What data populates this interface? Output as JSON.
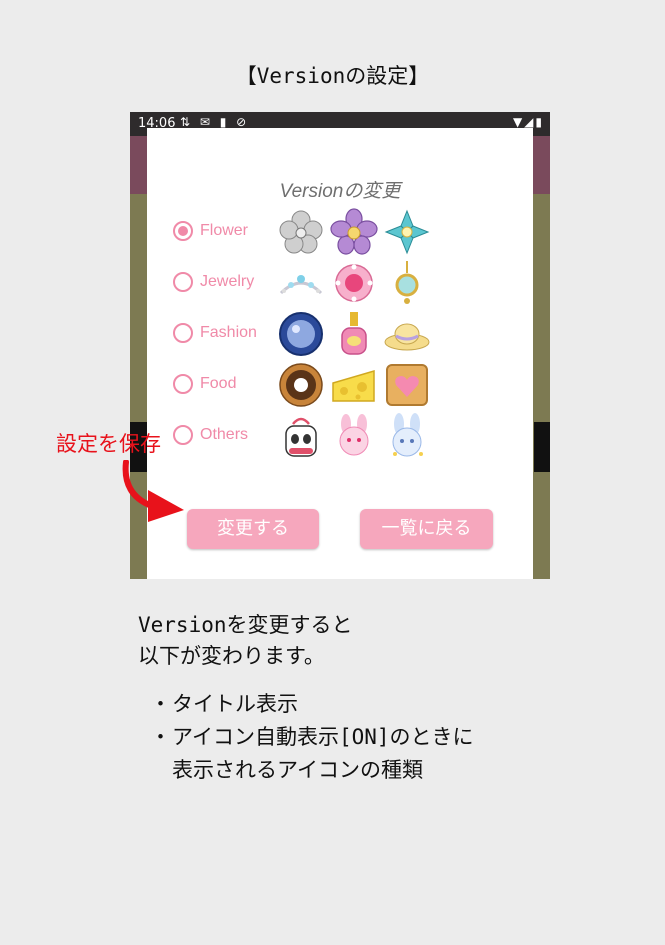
{
  "page_title": "【Versionの設定】",
  "status_bar": {
    "time": "14:06",
    "left_icons": "⇅ ✉ ▮ ⊘",
    "right_icons": "▼◢▮"
  },
  "dialog": {
    "title": "Versionの変更",
    "options": [
      {
        "label": "Flower",
        "checked": true,
        "icons": [
          "silver-flower-icon",
          "purple-flower-icon",
          "turquoise-flower-icon"
        ]
      },
      {
        "label": "Jewelry",
        "checked": false,
        "icons": [
          "tiara-icon",
          "pink-brooch-icon",
          "pendant-icon"
        ]
      },
      {
        "label": "Fashion",
        "checked": false,
        "icons": [
          "compact-mirror-icon",
          "perfume-bottle-icon",
          "straw-hat-icon"
        ]
      },
      {
        "label": "Food",
        "checked": false,
        "icons": [
          "donut-icon",
          "cheese-icon",
          "heart-biscuit-icon"
        ]
      },
      {
        "label": "Others",
        "checked": false,
        "icons": [
          "panda-bag-icon",
          "pink-bunny-icon",
          "blue-bunny-icon"
        ]
      }
    ],
    "buttons": {
      "change": "変更する",
      "back": "一覧に戻る"
    }
  },
  "callout": "設定を保存",
  "description": {
    "line1": "Versionを変更すると",
    "line2": "以下が変わります。"
  },
  "bullets": {
    "dot": "・",
    "item1": "タイトル表示",
    "item2_line1": "アイコン自動表示[ON]のときに",
    "item2_line2": "表示されるアイコンの種類"
  },
  "colors": {
    "accent_pink": "#f08aa8",
    "button_pink": "#f6a7bd",
    "callout_red": "#e8121b"
  }
}
